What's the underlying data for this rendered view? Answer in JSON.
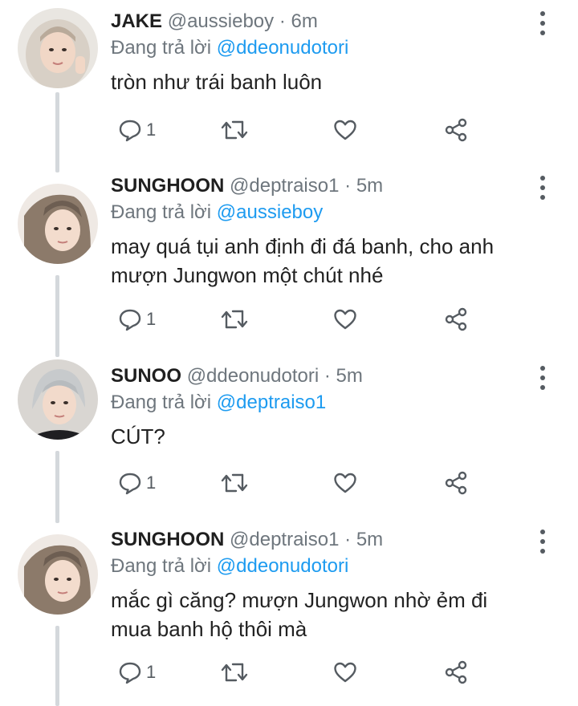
{
  "tweets": [
    {
      "name": "JAKE",
      "handle": "@aussieboy",
      "dot": "·",
      "time": "6m",
      "reply_prefix": "Đang trả lời",
      "reply_to": "@ddeonudotori",
      "body": "tròn như trái banh luôn",
      "reply_count": "1",
      "avatar_icon": "avatar-photo"
    },
    {
      "name": "SUNGHOON",
      "handle": "@deptraiso1",
      "dot": "·",
      "time": "5m",
      "reply_prefix": "Đang trả lời",
      "reply_to": "@aussieboy",
      "body": "may quá tụi anh định đi đá banh, cho anh mượn Jungwon một chút nhé",
      "reply_count": "1",
      "avatar_icon": "avatar-photo"
    },
    {
      "name": "SUNOO",
      "handle": "@ddeonudotori",
      "dot": "·",
      "time": "5m",
      "reply_prefix": "Đang trả lời",
      "reply_to": "@deptraiso1",
      "body": "CÚT?",
      "reply_count": "1",
      "avatar_icon": "avatar-photo"
    },
    {
      "name": "SUNGHOON",
      "handle": "@deptraiso1",
      "dot": "·",
      "time": "5m",
      "reply_prefix": "Đang trả lời",
      "reply_to": "@ddeonudotori",
      "body": "mắc gì căng? mượn Jungwon nhờ ẻm đi mua banh hộ thôi mà",
      "reply_count": "1",
      "avatar_icon": "avatar-photo"
    }
  ],
  "icons": {
    "reply": "comment-icon",
    "retweet": "retweet-icon",
    "like": "heart-icon",
    "share": "share-icon",
    "more": "more-vertical-icon"
  },
  "colors": {
    "mention": "#1d9bf0",
    "secondary_text": "#6e767d",
    "thread_line": "#d4d8dc",
    "icon": "#555b61"
  }
}
